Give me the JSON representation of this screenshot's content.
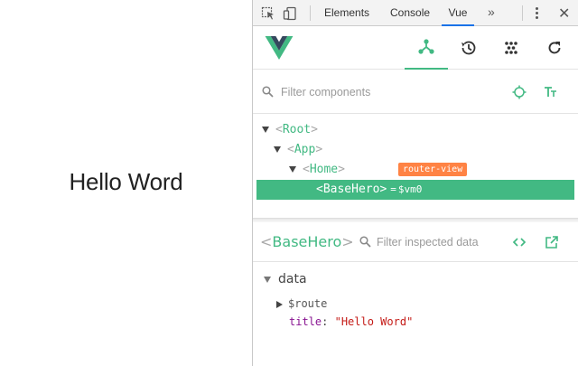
{
  "page": {
    "heading": "Hello Word"
  },
  "devtools": {
    "tabs": [
      {
        "label": "Elements",
        "active": false
      },
      {
        "label": "Console",
        "active": false
      },
      {
        "label": "Vue",
        "active": true
      }
    ],
    "more_label": "»",
    "accent": "#1a73e8"
  },
  "vue": {
    "accent": "#42b983",
    "header_buttons": [
      "components-icon",
      "history-icon",
      "vuex-icon",
      "refresh-icon"
    ],
    "filter": {
      "placeholder": "Filter components",
      "value": ""
    },
    "tree": [
      {
        "open": "<",
        "name": "Root",
        "close": ">"
      },
      {
        "open": "<",
        "name": "App",
        "close": ">"
      },
      {
        "open": "<",
        "name": "Home",
        "close": ">",
        "badge": "router-view"
      },
      {
        "open": "<",
        "name": "BaseHero",
        "close": ">",
        "selected": true,
        "eq": "=",
        "vm": "$vm0"
      }
    ],
    "inspector": {
      "open": "<",
      "name": "BaseHero",
      "close": ">",
      "filter_placeholder": "Filter inspected data",
      "section": "data",
      "items": [
        {
          "key": "$route",
          "expandable": true
        },
        {
          "key": "title",
          "colon": ":",
          "value": "\"Hello Word\""
        }
      ]
    }
  }
}
